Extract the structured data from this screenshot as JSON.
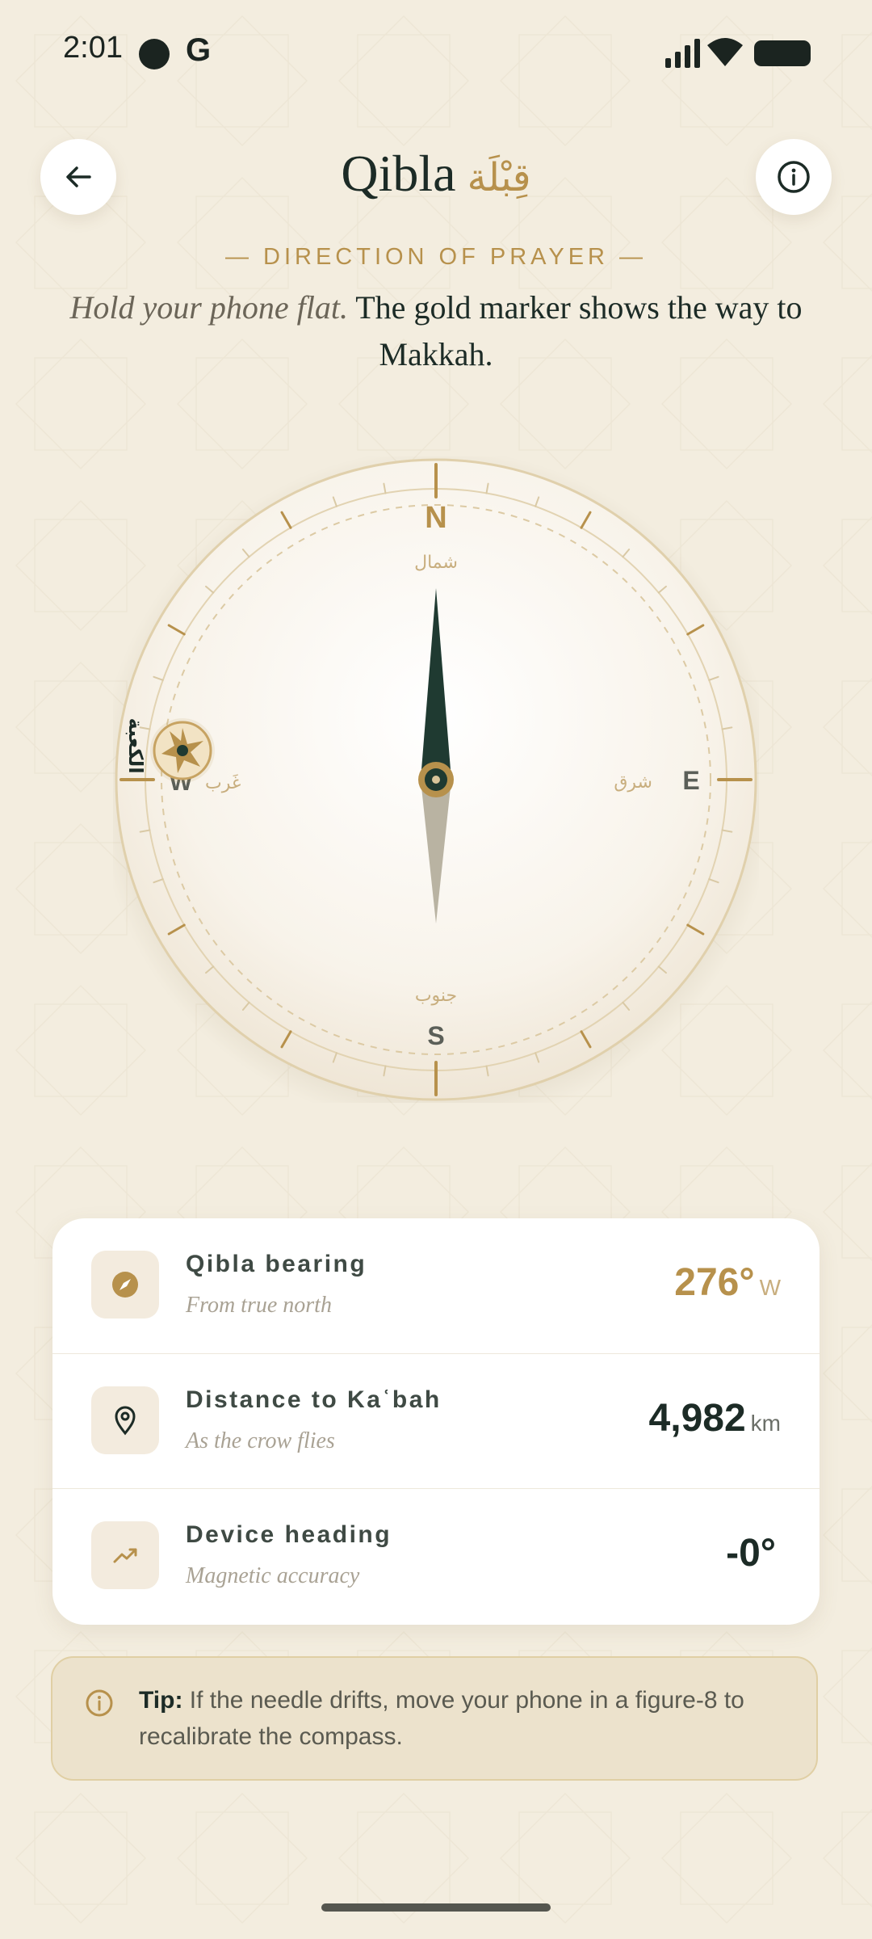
{
  "status_bar": {
    "time": "2:01",
    "g_label": "G"
  },
  "header": {
    "title": "Qibla",
    "title_arabic": "قِبْلَة"
  },
  "eyebrow": "— DIRECTION OF PRAYER —",
  "lead": {
    "italic": "Hold your phone flat.",
    "text": "The gold marker shows the way to Makkah."
  },
  "compass": {
    "north": "N",
    "south": "S",
    "east": "E",
    "west": "W",
    "north_ar": "شمال",
    "south_ar": "جنوب",
    "east_ar": "شرق",
    "west_ar": "غَرب",
    "kaaba_label": "الكعبة",
    "marker_bearing_deg": 276,
    "colors": {
      "gold": "#b7914c",
      "needle_dark": "#1f3a31",
      "needle_light": "#b9b3a2"
    }
  },
  "info_rows": [
    {
      "icon": "compass-icon",
      "label": "Qibla bearing",
      "sub": "From true north",
      "value": "276°",
      "unit": "W"
    },
    {
      "icon": "location-pin-icon",
      "label": "Distance to Kaʿbah",
      "sub": "As the crow flies",
      "value": "4,982",
      "unit": "km"
    },
    {
      "icon": "trend-icon",
      "label": "Device heading",
      "sub": "Magnetic accuracy",
      "value": "-0°",
      "unit": ""
    }
  ],
  "tip": {
    "label": "Tip:",
    "text": "If the needle drifts, move your phone in a figure-8 to recalibrate the compass."
  }
}
